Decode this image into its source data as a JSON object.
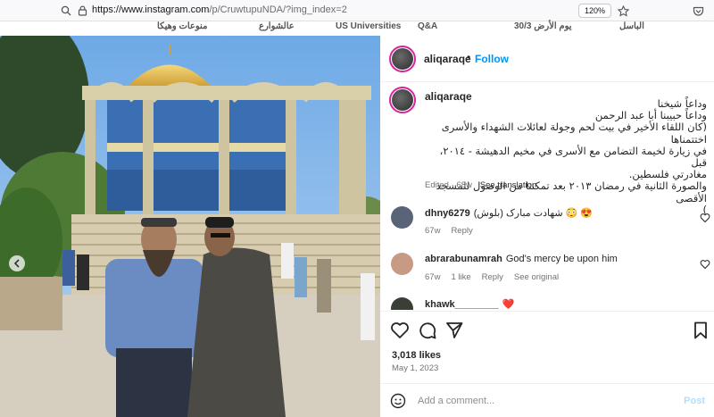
{
  "browser": {
    "url_host": "https://www.instagram.com",
    "url_rest": "/p/CruwtupuNDA/?img_index=2",
    "zoom": "120%"
  },
  "background_site": {
    "nav_items": [
      "الباسل",
      "يوم الأرض 30/3",
      "Q&A",
      "US Universities",
      "عالشوارع",
      "منوعات وهيكا"
    ]
  },
  "post": {
    "header": {
      "username": "aliqaraqe",
      "separator": "•",
      "follow_label": "Follow",
      "more_label": "•••"
    },
    "caption": {
      "username": "aliqaraqe",
      "lines": [
        "وداعاً شيخنا",
        "وداعاً حبيبنا أبا عبد الرحمن",
        "(كان اللقاء الأخير في بيت لحم وجولة لعائلات الشهداء والأسرى اختتمناها",
        "في زيارة لخيمة التضامن مع الأسرى في مخيم الدهيشة - ٢٠١٤، قبل",
        "مغادرتي فلسطين.",
        "والصورة الثانية في رمضان ٢٠١٣ بعد تمكننا من الوصول للمسجد الأقصى",
        ")"
      ],
      "edited": "Edited · 68w",
      "see_translation": "See translation"
    },
    "comments": [
      {
        "username": "dhny6279",
        "text": "شهادت مبارک (بلوش) 😳 😍",
        "age": "67w",
        "likes": "",
        "reply": "Reply",
        "see_original": ""
      },
      {
        "username": "abrarabunamrah",
        "text": "God's mercy be upon him",
        "age": "67w",
        "likes": "1 like",
        "reply": "Reply",
        "see_original": "See original"
      },
      {
        "username": "khawk________",
        "text": "❤️",
        "age": "",
        "likes": "",
        "reply": "",
        "see_original": ""
      }
    ],
    "likes": "3,018 likes",
    "date": "May 1, 2023",
    "add_comment_placeholder": "Add a comment...",
    "post_label": "Post"
  },
  "colors": {
    "accent": "#0095f6",
    "ring": "#d6249f",
    "muted": "#737373"
  }
}
